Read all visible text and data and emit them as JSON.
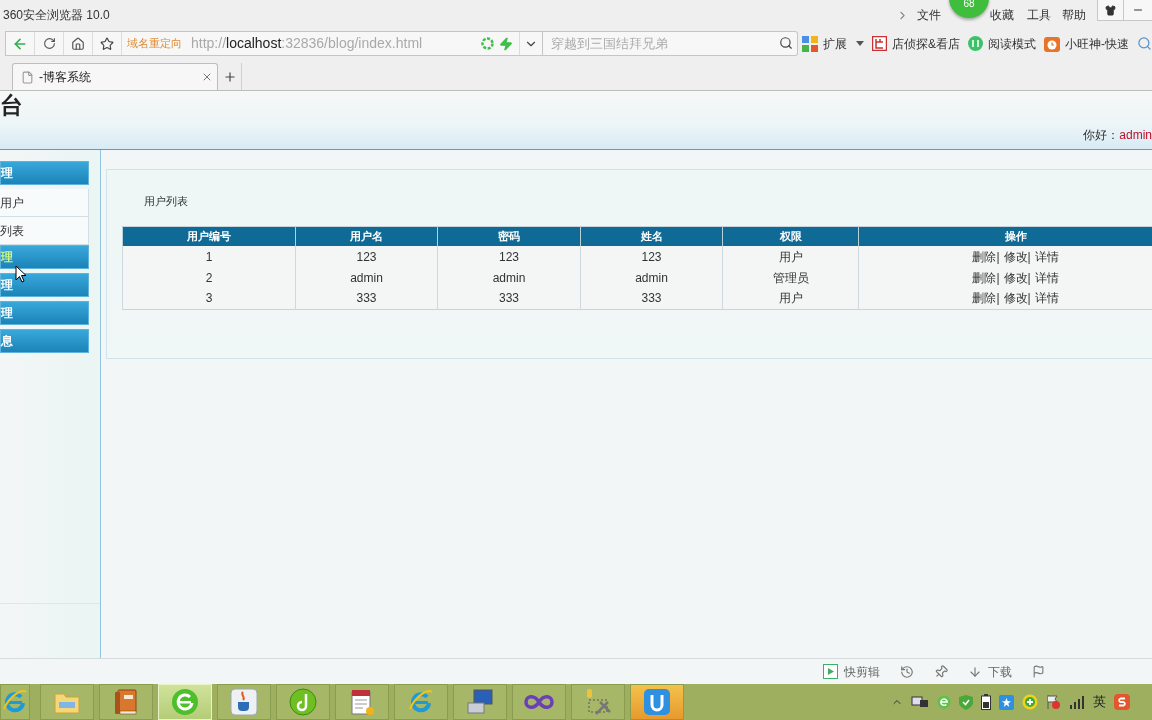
{
  "window": {
    "title": "360安全浏览器 10.0",
    "floating_ball": "68"
  },
  "menu": [
    "文件",
    "收藏",
    "工具",
    "帮助"
  ],
  "address_bar": {
    "redirect_label": "域名重定向",
    "url_scheme": "http://",
    "url_host": "localhost",
    "url_rest": ":32836/blog/index.html"
  },
  "search": {
    "placeholder": "穿越到三国结拜兄弟"
  },
  "bookmarks": [
    {
      "kind": "extensions",
      "label": "扩展"
    },
    {
      "kind": "shop",
      "label": "店侦探&看店"
    },
    {
      "kind": "reader",
      "label": "阅读模式"
    },
    {
      "kind": "alarm",
      "label": "小旺神-快速"
    }
  ],
  "tabs": [
    {
      "label": "-博客系统",
      "selected": true
    }
  ],
  "page": {
    "header_title": "台",
    "greeting": "你好：",
    "user": "admin",
    "sidebar": [
      {
        "kind": "group",
        "label": "理",
        "hovered": false
      },
      {
        "kind": "link",
        "label": "用户",
        "hovered": false
      },
      {
        "kind": "link",
        "label": "列表",
        "hovered": false
      },
      {
        "kind": "group",
        "label": "理",
        "hovered": true
      },
      {
        "kind": "group",
        "label": "理",
        "hovered": false
      },
      {
        "kind": "group",
        "label": "理",
        "hovered": false
      },
      {
        "kind": "group",
        "label": "息",
        "hovered": false
      }
    ],
    "panel": {
      "title": "用户列表",
      "table": {
        "columns": [
          "用户编号",
          "用户名",
          "密码",
          "姓名",
          "权限",
          "操作"
        ],
        "action_separator": "|",
        "rows": [
          {
            "cells": [
              "1",
              "123",
              "123",
              "123",
              "用户"
            ],
            "actions": [
              "删除",
              "修改",
              "详情"
            ]
          },
          {
            "cells": [
              "2",
              "admin",
              "admin",
              "admin",
              "管理员"
            ],
            "actions": [
              "删除",
              "修改",
              "详情"
            ]
          },
          {
            "cells": [
              "3",
              "333",
              "333",
              "333",
              "用户"
            ],
            "actions": [
              "删除",
              "修改",
              "详情"
            ]
          }
        ]
      }
    }
  },
  "status_bar": [
    {
      "kind": "clip",
      "label": "快剪辑"
    },
    {
      "kind": "history"
    },
    {
      "kind": "pin"
    },
    {
      "kind": "download",
      "label": "下载"
    },
    {
      "kind": "flag"
    }
  ],
  "taskbar": {
    "apps": [
      {
        "kind": "ie",
        "selected": false,
        "attention": false
      },
      {
        "kind": "explorer",
        "selected": false,
        "attention": false
      },
      {
        "kind": "book",
        "selected": false,
        "attention": false
      },
      {
        "kind": "browser",
        "selected": true,
        "attention": false
      },
      {
        "kind": "java",
        "selected": false,
        "attention": false
      },
      {
        "kind": "disc",
        "selected": false,
        "attention": false
      },
      {
        "kind": "notepad",
        "selected": false,
        "attention": false
      },
      {
        "kind": "ie",
        "selected": false,
        "attention": false
      },
      {
        "kind": "computer",
        "selected": false,
        "attention": false
      },
      {
        "kind": "infinity",
        "selected": false,
        "attention": false
      },
      {
        "kind": "tools",
        "selected": false,
        "attention": false
      },
      {
        "kind": "app",
        "selected": false,
        "attention": true
      }
    ],
    "tray_language": "英"
  }
}
